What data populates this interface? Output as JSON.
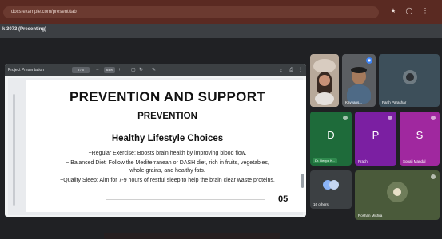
{
  "browser": {
    "url": "docs.example.com/present/tab",
    "star_icon": "star-icon",
    "profile_icon": "profile-icon",
    "menu_icon": "menu-icon"
  },
  "meet": {
    "title": "k 3073 (Presenting)"
  },
  "presentation": {
    "file_name": "Project Presentation",
    "page_indicator": "5 / 5",
    "zoom": "64%",
    "slide": {
      "title": "PREVENTION AND SUPPORT",
      "subtitle": "PREVENTION",
      "section": "Healthy Lifestyle Choices",
      "lines": [
        "~Regular Exercise: Boosts brain health by improving blood flow.",
        "~ Balanced Diet: Follow the Mediterranean or DASH diet, rich in fruits, vegetables,",
        "whole grains, and healthy fats.",
        "~Quality Sleep: Aim for 7-9 hours of restful sleep to help the brain clear waste proteins."
      ],
      "number": "05"
    }
  },
  "participants": {
    "p1": {
      "name": ""
    },
    "p2": {
      "name": "Kavyans..."
    },
    "p3": {
      "name": "Parth Parashar"
    },
    "p4": {
      "letter": "D",
      "name": "Dr. Deepa K..."
    },
    "p5": {
      "letter": "P",
      "name": "Prachi"
    },
    "p6": {
      "letter": "S",
      "name": "Sonali Mandal"
    },
    "p7": {
      "name": "16 others"
    },
    "p8": {
      "name": "Roshan Mishra"
    }
  },
  "colors": {
    "browser_bar": "#5a2a22",
    "meet_bg": "#202124",
    "tile_green": "#1e6b3a",
    "tile_purple": "#8e24aa",
    "tile_magenta": "#a0289f"
  }
}
